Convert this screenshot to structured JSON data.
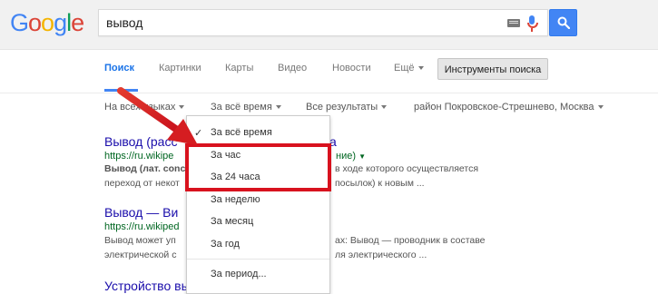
{
  "logo": {
    "text": "Google",
    "letters": [
      "G",
      "o",
      "o",
      "g",
      "l",
      "e"
    ],
    "colors": [
      "#4285f4",
      "#db4437",
      "#f4b400",
      "#4285f4",
      "#0f9d58",
      "#db4437"
    ]
  },
  "search": {
    "query": "вывод",
    "placeholder": ""
  },
  "tabs": [
    {
      "label": "Поиск",
      "active": true
    },
    {
      "label": "Картинки"
    },
    {
      "label": "Карты"
    },
    {
      "label": "Видео"
    },
    {
      "label": "Новости"
    },
    {
      "label": "Ещё"
    }
  ],
  "tools_button": "Инструменты поиска",
  "filters": {
    "language": "На всех языках",
    "time": "За всё время",
    "results": "Все результаты",
    "location": "район Покровское-Стрешнево, Москва"
  },
  "results": [
    {
      "title": "Вывод (расс",
      "title_tail": "а",
      "url": "https://ru.wikipe",
      "url_tail": "ние)",
      "snippet_1": "Вывод (лат. conc",
      "snippet_1_tail": "в ходе которого осуществляется",
      "snippet_2": "переход от некот",
      "snippet_2_tail": "посылок) к новым ..."
    },
    {
      "title": "Вывод — Ви",
      "url": "https://ru.wikiped",
      "snippet_1": "Вывод может уп",
      "snippet_1_tail": "ах: Вывод — проводник в составе",
      "snippet_2": "электрической с",
      "snippet_2_tail": "ля электрического ..."
    },
    {
      "title": "Устройство вывод"
    }
  ],
  "time_menu": {
    "items": [
      "За всё время",
      "За час",
      "За 24 часа",
      "За неделю",
      "За месяц",
      "За год"
    ],
    "selected_index": 0,
    "custom": "За период..."
  },
  "colors": {
    "accent": "#4285f4",
    "highlight": "#d8121e",
    "link": "#1a0dab",
    "url": "#006621"
  },
  "icons": [
    "keyboard-icon",
    "microphone-icon",
    "search-icon",
    "check-icon",
    "caret-down-icon"
  ]
}
